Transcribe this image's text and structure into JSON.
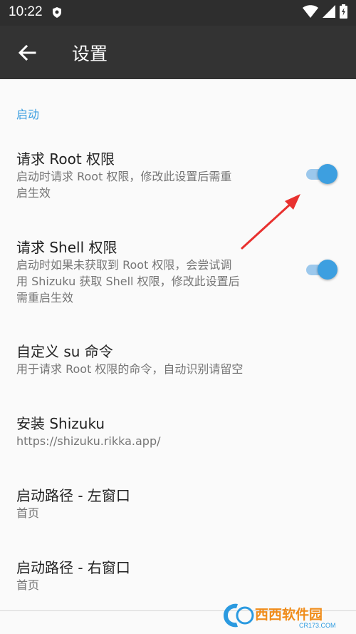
{
  "status_bar": {
    "time": "10:22",
    "icons": [
      "shield-icon",
      "wifi-icon",
      "signal-icon",
      "battery-charging-icon"
    ]
  },
  "app_bar": {
    "back_icon": "arrow-left-icon",
    "title": "设置"
  },
  "section": {
    "title": "启动"
  },
  "preferences": [
    {
      "title": "请求 Root 权限",
      "summary_lines": [
        "启动时请求 Root 权限，修改此设置后需重",
        "启生效"
      ],
      "switch_on": true
    },
    {
      "title": "请求 Shell 权限",
      "summary_lines": [
        "启动时如果未获取到 Root 权限，会尝试调",
        "用 Shizuku 获取 Shell 权限，修改此设置后",
        "需重启生效"
      ],
      "switch_on": true
    },
    {
      "title": "自定义 su 命令",
      "summary_lines": [
        "用于请求 Root 权限的命令，自动识别请留空"
      ]
    },
    {
      "title": "安装 Shizuku",
      "summary_lines": [
        "https://shizuku.rikka.app/"
      ]
    },
    {
      "title": "启动路径 - 左窗口",
      "summary_lines": [
        "首页"
      ]
    },
    {
      "title": "启动路径 - 右窗口",
      "summary_lines": [
        "首页"
      ]
    }
  ],
  "colors": {
    "accent": "#3d9fe0",
    "app_bar": "#333333",
    "status_bar": "#2e2e2e",
    "annotation_arrow": "#e8312f"
  },
  "watermark": {
    "main": "西西软件园",
    "sub": "CR173.COM"
  }
}
